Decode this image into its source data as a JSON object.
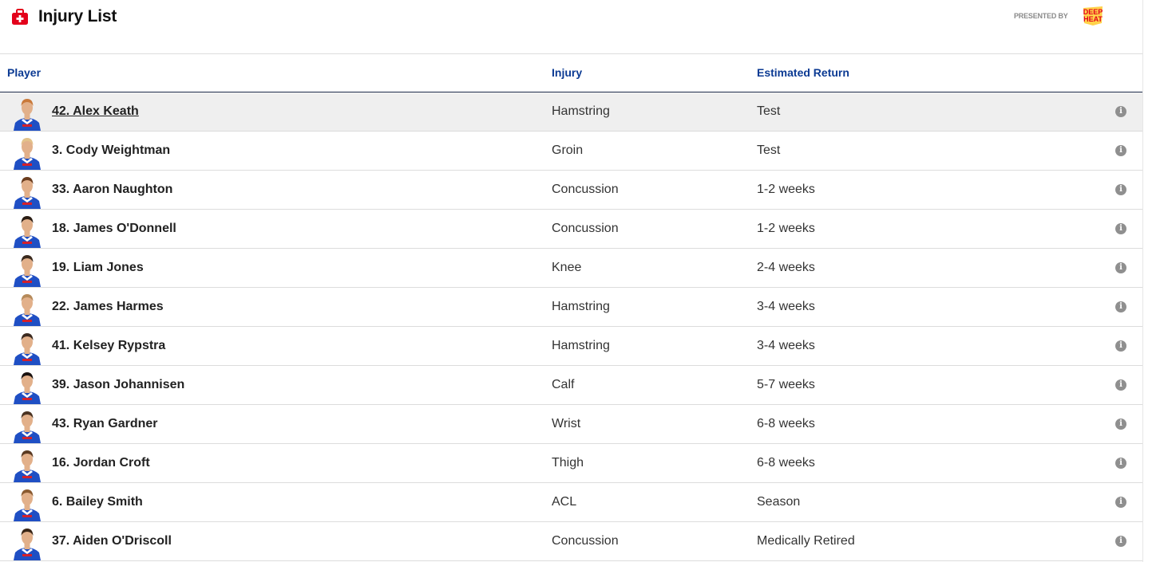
{
  "header": {
    "title": "Injury List",
    "icon": "first-aid-kit-icon",
    "presented_by": "PRESENTED BY",
    "sponsor_line1": "DEEP",
    "sponsor_line2": "HEAT",
    "accent": "#e3001b"
  },
  "columns": {
    "player": "Player",
    "injury": "Injury",
    "estimated_return": "Estimated Return"
  },
  "rows": [
    {
      "player": "42. Alex Keath",
      "injury": "Hamstring",
      "return": "Test",
      "hair": "#c9793a"
    },
    {
      "player": "3. Cody Weightman",
      "injury": "Groin",
      "return": "Test",
      "hair": "#e3c28a"
    },
    {
      "player": "33. Aaron Naughton",
      "injury": "Concussion",
      "return": "1-2 weeks",
      "hair": "#6b3d1e"
    },
    {
      "player": "18. James O'Donnell",
      "injury": "Concussion",
      "return": "1-2 weeks",
      "hair": "#2a1d14"
    },
    {
      "player": "19. Liam Jones",
      "injury": "Knee",
      "return": "2-4 weeks",
      "hair": "#3a2a1e"
    },
    {
      "player": "22. James Harmes",
      "injury": "Hamstring",
      "return": "3-4 weeks",
      "hair": "#b58a5a"
    },
    {
      "player": "41. Kelsey Rypstra",
      "injury": "Hamstring",
      "return": "3-4 weeks",
      "hair": "#3b2a20"
    },
    {
      "player": "39. Jason Johannisen",
      "injury": "Calf",
      "return": "5-7 weeks",
      "hair": "#1a1210"
    },
    {
      "player": "43. Ryan Gardner",
      "injury": "Wrist",
      "return": "6-8 weeks",
      "hair": "#4a3322"
    },
    {
      "player": "16. Jordan Croft",
      "injury": "Thigh",
      "return": "6-8 weeks",
      "hair": "#5a3a22"
    },
    {
      "player": "6. Bailey Smith",
      "injury": "ACL",
      "return": "Season",
      "hair": "#8a5a30"
    },
    {
      "player": "37. Aiden O'Driscoll",
      "injury": "Concussion",
      "return": "Medically Retired",
      "hair": "#3a2616"
    }
  ],
  "info_glyph": "i",
  "colors": {
    "heading_blue": "#0b3a93",
    "guernsey_blue": "#1f4fc4",
    "guernsey_red": "#d4202a",
    "skin": "#e2b08a"
  }
}
